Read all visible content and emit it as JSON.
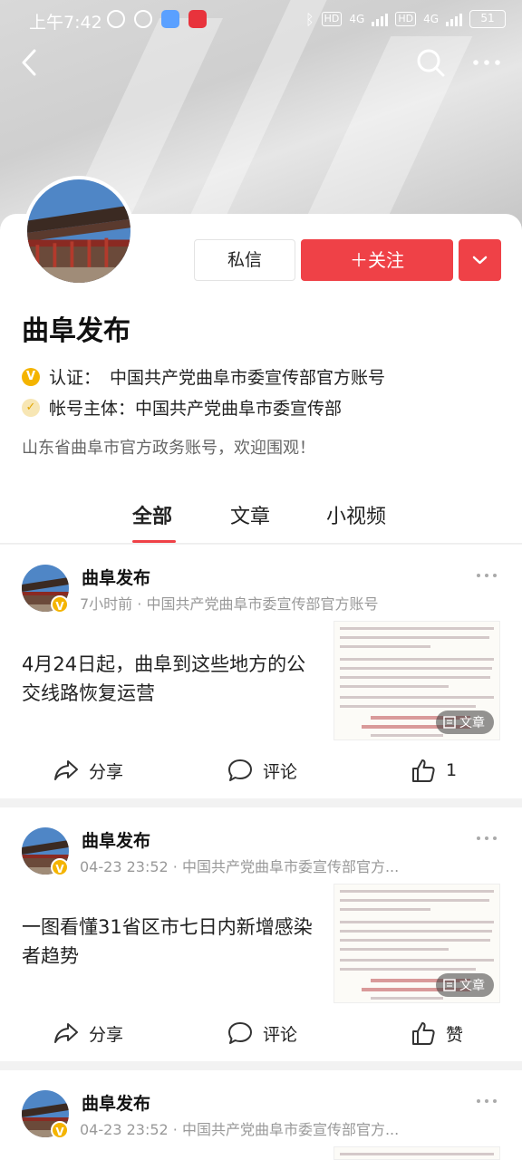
{
  "status_bar": {
    "time": "上午7:42",
    "hd1": "HD",
    "net1": "4G",
    "hd2": "HD",
    "net2": "4G",
    "battery": "51"
  },
  "nav": {
    "back_icon": "back-arrow-icon",
    "search_icon": "search-icon",
    "more_icon": "more-dots-icon"
  },
  "profile": {
    "name": "曲阜发布",
    "message_label": "私信",
    "follow_label": "＋关注",
    "certification_label": "认证：",
    "certification_value": "中国共产党曲阜市委宣传部官方账号",
    "entity_label": "帐号主体：",
    "entity_value": "中国共产党曲阜市委宣传部",
    "intro": "山东省曲阜市官方政务账号，欢迎围观！",
    "accent_color": "#ef4147"
  },
  "tabs": [
    {
      "label": "全部",
      "active": true
    },
    {
      "label": "文章",
      "active": false
    },
    {
      "label": "小视频",
      "active": false
    }
  ],
  "posts": [
    {
      "author": "曲阜发布",
      "meta": "7小时前 · 中国共产党曲阜市委宣传部官方账号",
      "title": "4月24日起，曲阜到这些地方的公交线路恢复运营",
      "thumb_badge": "文章",
      "share_label": "分享",
      "comment_label": "评论",
      "like_label": "1"
    },
    {
      "author": "曲阜发布",
      "meta": "04-23 23:52 · 中国共产党曲阜市委宣传部官方...",
      "title": "一图看懂31省区市七日内新增感染者趋势",
      "thumb_badge": "文章",
      "share_label": "分享",
      "comment_label": "评论",
      "like_label": "赞"
    },
    {
      "author": "曲阜发布",
      "meta": "04-23 23:52 · 中国共产党曲阜市委宣传部官方..."
    }
  ]
}
